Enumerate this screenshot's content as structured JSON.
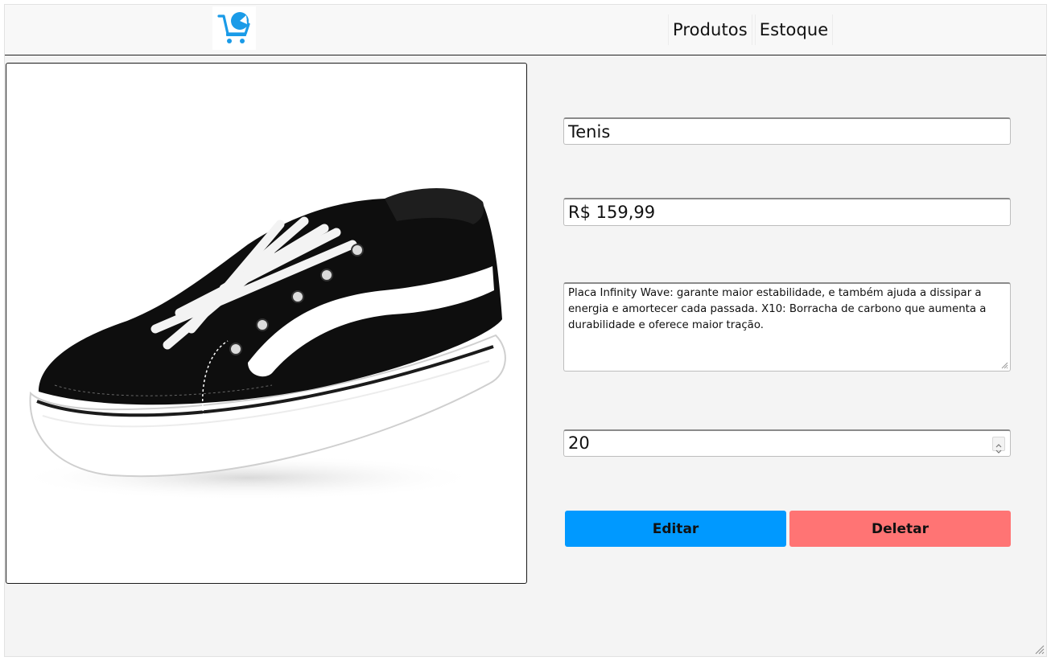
{
  "header": {
    "logo_icon": "cart-logo-icon",
    "nav": [
      {
        "label": "Produtos"
      },
      {
        "label": "Estoque"
      }
    ]
  },
  "product": {
    "image_icon": "sneaker-photo",
    "name": "Tenis",
    "price": "R$ 159,99",
    "description": "Placa Infinity Wave: garante maior estabilidade, e também ajuda a dissipar a energia e amortecer cada passada. X10: Borracha de carbono que aumenta a durabilidade e oferece maior tração.",
    "quantity": "20"
  },
  "actions": {
    "edit_label": "Editar",
    "delete_label": "Deletar"
  },
  "colors": {
    "brand": "#1a9be8",
    "edit": "#0099ff",
    "delete": "#ff7474",
    "background": "#f4f4f4"
  }
}
